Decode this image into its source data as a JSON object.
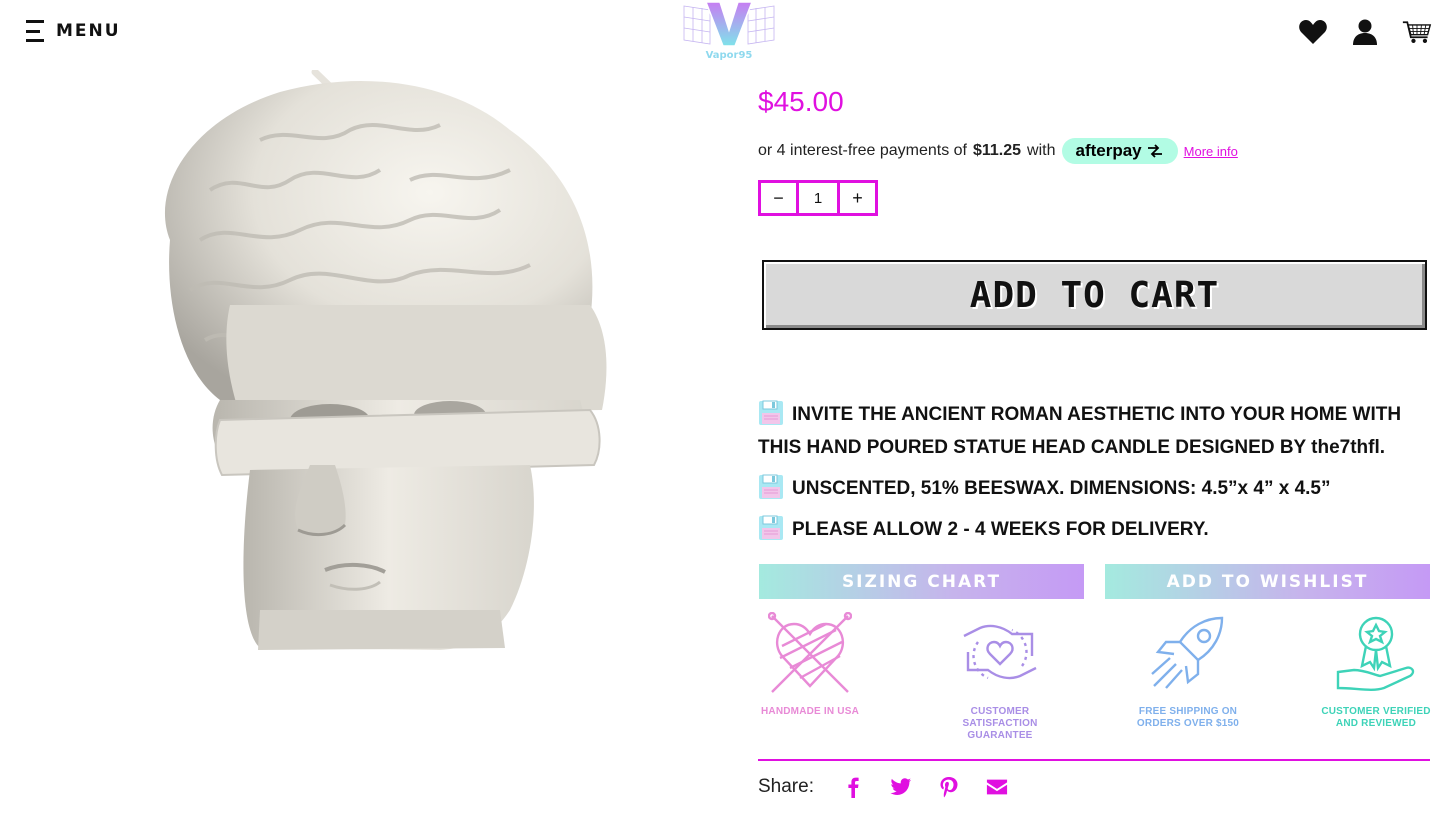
{
  "header": {
    "menu_label": "MENU",
    "logo_text": "Vapor95"
  },
  "product": {
    "price": "$45.00",
    "afterpay": {
      "prefix": "or 4 interest-free payments of",
      "amount": "$11.25",
      "with": "with",
      "brand": "afterpay",
      "more_info": "More info"
    },
    "quantity": {
      "minus": "−",
      "value": "1",
      "plus": "+"
    },
    "add_to_cart": "ADD TO CART",
    "description": [
      "INVITE THE ANCIENT ROMAN AESTHETIC INTO YOUR HOME WITH THIS HAND POURED STATUE HEAD CANDLE DESIGNED BY the7thfl.",
      "UNSCENTED, 51% BEESWAX. DIMENSIONS: 4.5”x 4” x 4.5”",
      "PLEASE ALLOW 2 - 4 WEEKS FOR DELIVERY."
    ],
    "sizing_chart": "SIZING CHART",
    "add_to_wishlist": "ADD TO WISHLIST"
  },
  "badges": [
    {
      "label": "HANDMADE IN USA",
      "icon": "yarn-heart-icon",
      "color": "#e88ad6"
    },
    {
      "label": "CUSTOMER SATISFACTION GUARANTEE",
      "icon": "hands-heart-icon",
      "color": "#a98ee6"
    },
    {
      "label": "FREE SHIPPING ON ORDERS OVER $150",
      "icon": "rocket-icon",
      "color": "#7fb0ec"
    },
    {
      "label": "CUSTOMER VERIFIED AND REVIEWED",
      "icon": "award-ribbon-icon",
      "color": "#3ed3b8"
    }
  ],
  "share": {
    "label": "Share:",
    "icons": [
      "facebook-icon",
      "twitter-icon",
      "pinterest-icon",
      "email-icon"
    ]
  },
  "colors": {
    "accent": "#e010e0",
    "afterpay": "#b2fce4",
    "pill_gradient_start": "#a4eadf",
    "pill_gradient_end": "#c59af5"
  }
}
